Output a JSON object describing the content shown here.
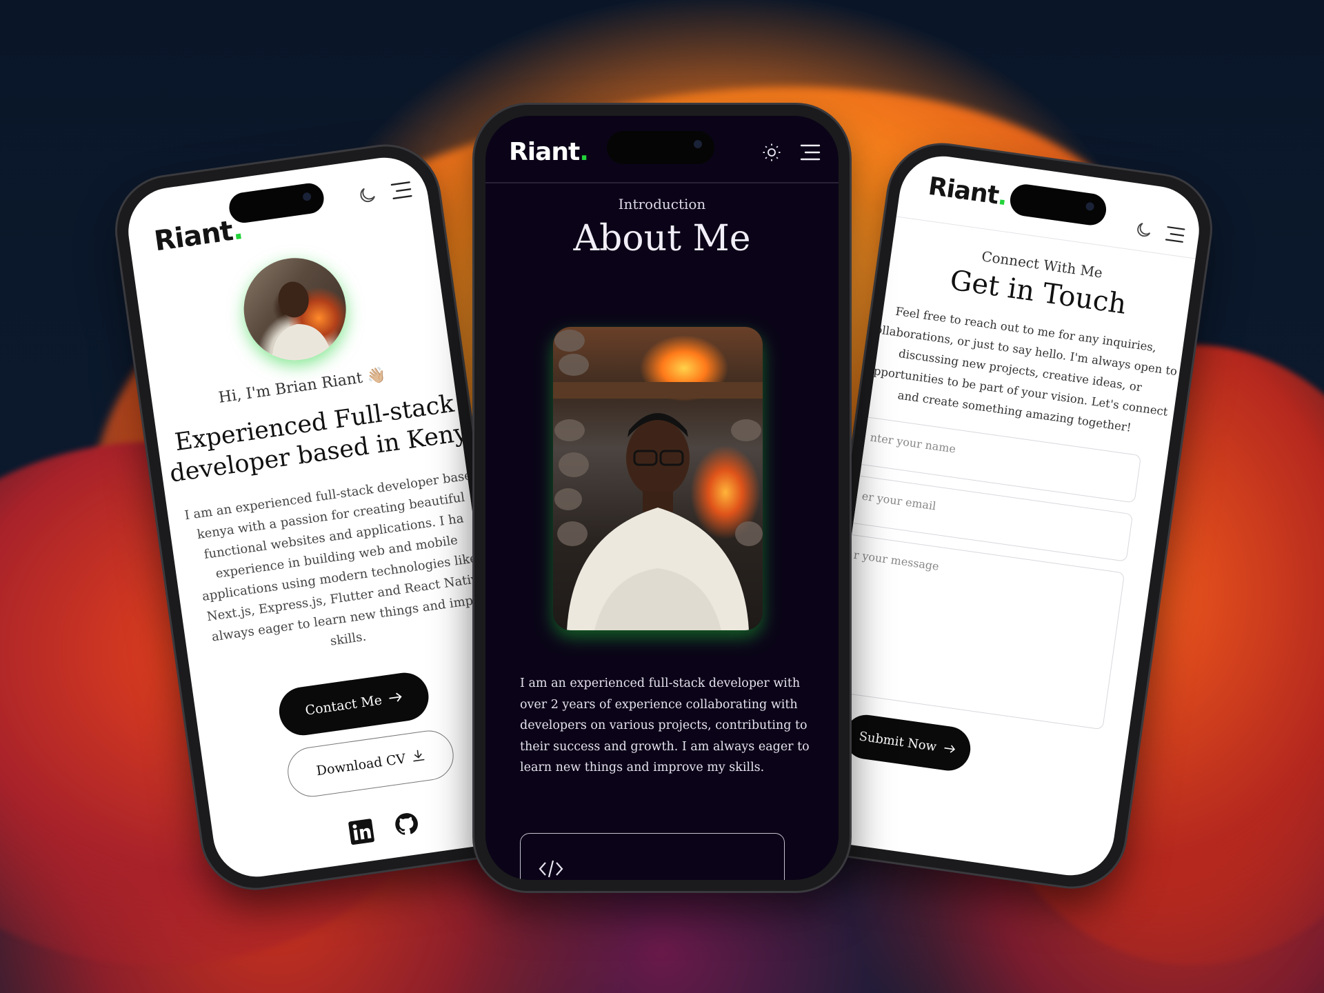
{
  "left_phone": {
    "logo": "Riant",
    "logo_dot": ".",
    "greeting": "Hi, I'm Brian Riant 👋🏼",
    "headline_line1": "Experienced Full-stack",
    "headline_line2": "developer based in Keny",
    "bio_lines": [
      "I am an experienced full-stack developer base",
      "kenya with a passion for creating beautiful",
      "functional websites and applications. I ha",
      "experience in building web and mobile",
      "applications using modern technologies like",
      "Next.js, Express.js, Flutter and React Nativ",
      "always eager to learn new things and impr",
      "skills."
    ],
    "contact_button": "Contact Me",
    "download_button": "Download CV",
    "icons": [
      "moon-icon",
      "menu-icon",
      "arrow-right-icon",
      "download-icon",
      "linkedin-icon",
      "github-icon"
    ]
  },
  "center_phone": {
    "logo": "Riant",
    "logo_dot": ".",
    "eyebrow": "Introduction",
    "title": "About Me",
    "bio_lines": [
      "I am an experienced full-stack developer with",
      "over 2 years of experience collaborating with",
      "developers on various projects, contributing to",
      "their success and growth. I am always eager to",
      "learn new things and improve my skills."
    ],
    "icons": [
      "sun-icon",
      "menu-icon",
      "code-icon"
    ]
  },
  "right_phone": {
    "logo": "Riant",
    "logo_dot": ".",
    "eyebrow": "Connect With Me",
    "title": "Get in Touch",
    "intro_lines": [
      "Feel free to reach out to me for any inquiries,",
      "collaborations, or just to say hello. I'm always open to",
      "discussing new projects, creative ideas, or",
      "opportunities to be part of your vision. Let's connect",
      "and create something amazing together!"
    ],
    "name_placeholder": "nter your name",
    "email_placeholder": "er your email",
    "message_placeholder": "r your message",
    "submit_button": "Submit Now",
    "icons": [
      "moon-icon",
      "menu-icon",
      "arrow-right-icon"
    ]
  },
  "colors": {
    "accent_green": "#22d33a",
    "dark_bg": "#0b0418",
    "light_bg": "#ffffff"
  }
}
